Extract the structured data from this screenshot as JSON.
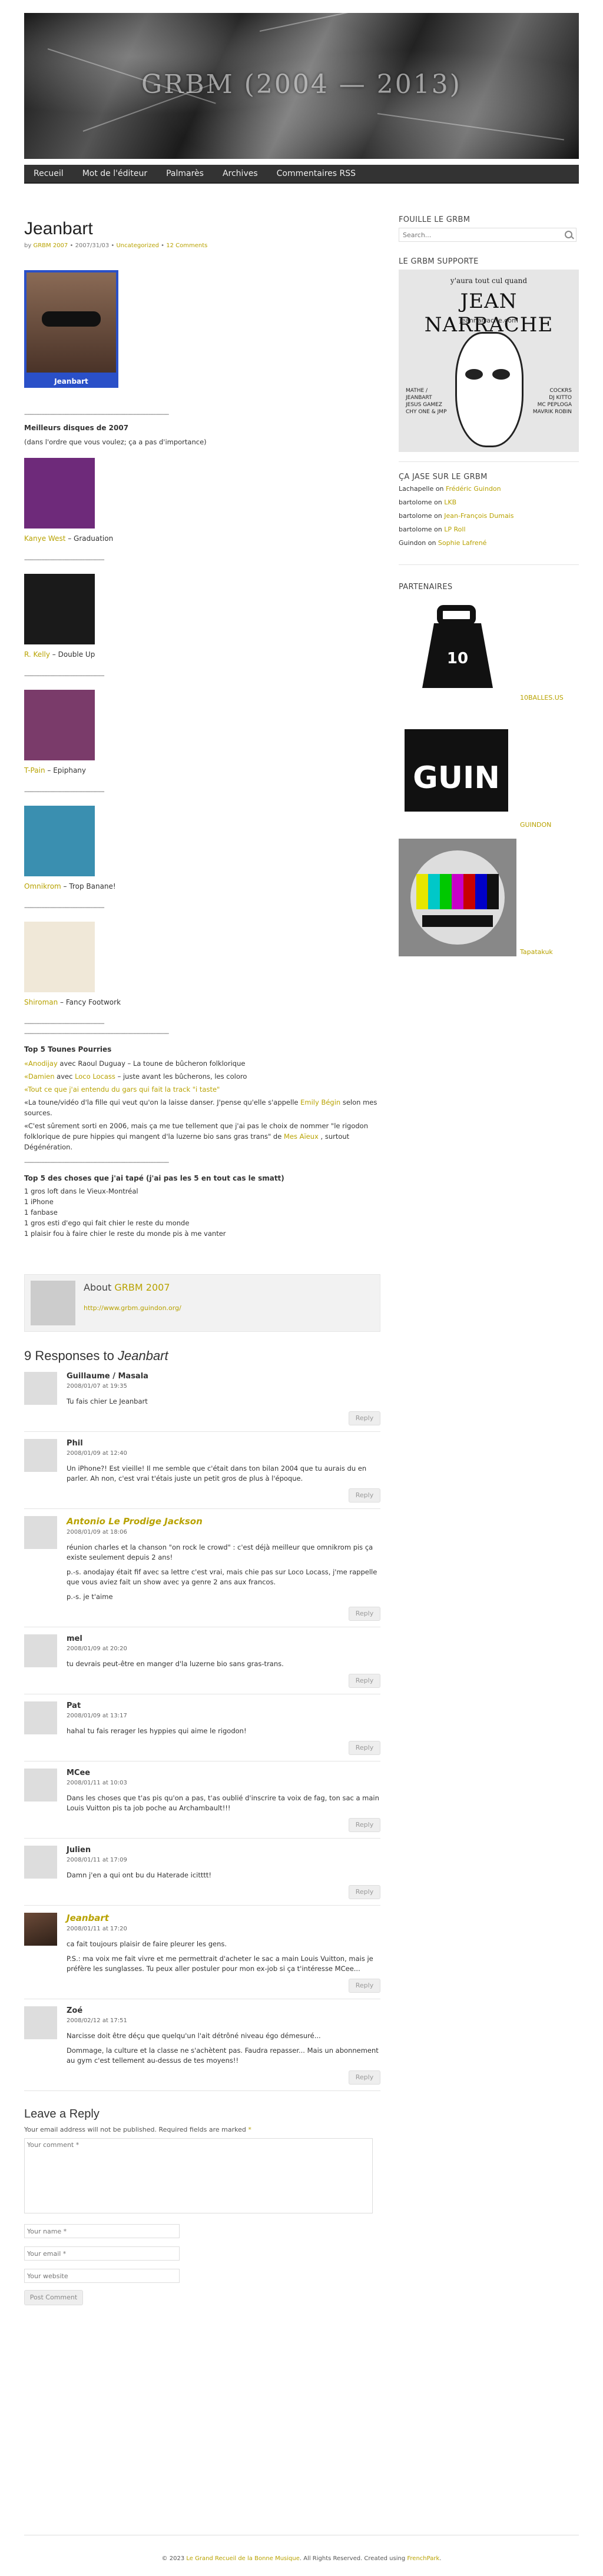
{
  "site": {
    "title": "GRBM (2004 — 2013)"
  },
  "nav": [
    {
      "label": "Recueil"
    },
    {
      "label": "Mot de l'éditeur"
    },
    {
      "label": "Palmarès"
    },
    {
      "label": "Archives"
    },
    {
      "label": "Commentaires RSS"
    }
  ],
  "post": {
    "title": "Jeanbart",
    "meta_by": "by",
    "meta_author": "GRBM 2007",
    "meta_sep1": "•",
    "meta_date": "2007/31/03",
    "meta_sep2": "•",
    "meta_category": "Uncategorized",
    "meta_sep3": "•",
    "meta_comments": "12 Comments",
    "avatar_caption": "Jeanbart",
    "separator": "----------------------------------------------------------------------------------------------",
    "separator_short": "----------------------------------------------------",
    "best_heading": "Meilleurs disques de 2007",
    "best_sub": "(dans l'ordre que vous voulez; ça a pas d'importance)",
    "albums": [
      {
        "artist": "Kanye West",
        "title": " – Graduation",
        "cover_color": "#6e2a7a"
      },
      {
        "artist": "R. Kelly",
        "title": " – Double Up",
        "cover_color": "#1a1a1a"
      },
      {
        "artist": "T-Pain",
        "title": " – Epiphany",
        "cover_color": "#7a3b6a"
      },
      {
        "artist": "Omnikrom",
        "title": " – Trop Banane!",
        "cover_color": "#3a8fb0"
      },
      {
        "artist": "Shiroman",
        "title": " – Fancy Footwork",
        "cover_color": "#f0e8d8"
      }
    ],
    "tounes_heading": "Top 5 Tounes Pourries",
    "tounes": [
      {
        "link": "«Anodijay",
        "rest": " avec Raoul Duguay – La toune de bûcheron folklorique"
      },
      {
        "link": "«Damien",
        "rest": " avec ",
        "link2": "Loco Locass",
        "rest2": " – juste avant les bûcherons, les coloro"
      },
      {
        "link": "«Tout ce que j'ai entendu du gars qui fait la track \"i taste\"",
        "rest": ""
      },
      {
        "link": "",
        "rest": "«La toune/vidéo d'la fille qui veut qu'on la laisse danser. J'pense qu'elle s'appelle ",
        "link2": "Emily Bégin",
        "rest2": " selon mes sources."
      },
      {
        "link": "",
        "rest": "«C'est sûrement sorti en 2006, mais ça me tue tellement que j'ai pas le choix de nommer \"le rigodon folklorique de pure hippies qui mangent d'la luzerne bio sans gras trans\" de ",
        "link2": "Mes Aïeux",
        "rest2": " , surtout Dégénération."
      }
    ],
    "choses_heading": "Top 5 des choses que j'ai tapé (j'ai pas les 5 en tout cas le smatt)",
    "choses": [
      "1 gros loft dans le Vieux-Montréal",
      "1 iPhone",
      "1 fanbase",
      "1 gros esti d'ego qui fait chier le reste du monde",
      "1 plaisir fou à faire chier le reste du monde pis à me vanter"
    ],
    "about_label": "About",
    "about_name": "GRBM 2007",
    "about_url": "http://www.grbm.guindon.org/"
  },
  "comments_heading_count": "9 Responses to",
  "comments_heading_title": "Jeanbart",
  "comments": [
    {
      "name": "Guillaume / Masala",
      "date": "2008/01/07 at 19:35",
      "texts": [
        "Tu fais chier Le Jeanbart"
      ],
      "author": false,
      "photo": false,
      "reply": "Reply"
    },
    {
      "name": "Phil",
      "date": "2008/01/09 at 12:40",
      "texts": [
        "Un iPhone?! Est vieille! Il me semble que c'était dans ton bilan 2004 que tu aurais du en parler. Ah non, c'est vrai t'étais juste un petit gros de plus à l'époque."
      ],
      "author": false,
      "photo": false,
      "reply": "Reply"
    },
    {
      "name": "Antonio Le Prodige Jackson",
      "date": "2008/01/09 at 18:06",
      "texts": [
        "réunion charles et la chanson \"on rock le crowd\" : c'est déjà meilleur que omnikrom pis ça existe seulement depuis 2 ans!",
        "p.-s. anodajay était fif avec sa lettre c'est vrai, mais chie pas sur Loco Locass, j'me rappelle que vous aviez fait un show avec ya genre 2 ans aux francos.",
        "p.-s. je t'aime"
      ],
      "author": true,
      "photo": false,
      "reply": "Reply"
    },
    {
      "name": "mel",
      "date": "2008/01/09 at 20:20",
      "texts": [
        "tu devrais peut-être en manger d'la luzerne bio sans gras-trans."
      ],
      "author": false,
      "photo": false,
      "reply": "Reply"
    },
    {
      "name": "Pat",
      "date": "2008/01/09 at 13:17",
      "texts": [
        "hahal tu fais rerager les hyppies qui aime le rigodon!"
      ],
      "author": false,
      "photo": false,
      "reply": "Reply"
    },
    {
      "name": "MCee",
      "date": "2008/01/11 at 10:03",
      "texts": [
        "Dans les choses que t'as pis qu'on a pas, t'as oublié d'inscrire ta voix de fag, ton sac a main Louis Vuitton pis ta job poche au Archambault!!!"
      ],
      "author": false,
      "photo": false,
      "reply": "Reply"
    },
    {
      "name": "Julien",
      "date": "2008/01/11 at 17:09",
      "texts": [
        "Damn j'en a qui ont bu du Haterade icitttt!"
      ],
      "author": false,
      "photo": false,
      "reply": "Reply"
    },
    {
      "name": "Jeanbart",
      "date": "2008/01/11 at 17:20",
      "texts": [
        "ca fait toujours plaisir de faire pleurer les gens.",
        "P.S.: ma voix me fait vivre et me permettrait d'acheter le sac a main Louis Vuitton, mais je préfère les sunglasses. Tu peux aller postuler pour mon ex-job si ça t'intéresse MCee..."
      ],
      "author": true,
      "photo": true,
      "reply": "Reply"
    },
    {
      "name": "Zoé",
      "date": "2008/02/12 at 17:51",
      "texts": [
        "Narcisse doit être déçu que quelqu'un l'ait détrôné niveau égo démesuré...",
        "Dommage, la culture et la classe ne s'achètent pas. Faudra repasser... Mais un abonnement au gym c'est tellement au-dessus de tes moyens!!"
      ],
      "author": false,
      "photo": false,
      "reply": "Reply"
    }
  ],
  "reply_form": {
    "title": "Leave a Reply",
    "notes": "Your email address will not be published. Required fields are marked",
    "required_mark": "*",
    "comment_placeholder": "Your comment *",
    "name_placeholder": "Your name *",
    "email_placeholder": "Your email *",
    "website_placeholder": "Your website",
    "submit_label": "Post Comment"
  },
  "sidebar": {
    "search_title": "FOUILLE LE GRBM",
    "search_placeholder": "Search...",
    "support_title": "LE GRBM SUPPORTE",
    "poster": {
      "top": "y'aura tout cul quand",
      "name": "JEAN NARRACHE",
      "url": "jeannarrache.com",
      "left": "MATHE /\nJEANBART\nJESUS GAMEZ\nCHY ONE & JMP",
      "right": "COCKRS\nDJ KITTO\nMC PEPLOGA\nMAVRIK ROBIN"
    },
    "recent_title": "ÇA JASE SUR LE GRBM",
    "recent": [
      {
        "who": "Lachapelle",
        "on": " on ",
        "post": "Frédéric Guindon"
      },
      {
        "who": "bartolome",
        "on": " on ",
        "post": "LKB"
      },
      {
        "who": "bartolome",
        "on": " on ",
        "post": "Jean-François Dumais"
      },
      {
        "who": "bartolome",
        "on": " on ",
        "post": "LP Roll"
      },
      {
        "who": "Guindon",
        "on": " on ",
        "post": "Sophie Lafrené"
      }
    ],
    "partners_title": "PARTENAIRES",
    "partners": [
      {
        "label": "10BALLES.US"
      },
      {
        "label": "GUINDON"
      },
      {
        "label": "Tapatakuk"
      }
    ]
  },
  "footer": {
    "prefix": "© 2023",
    "site": "Le Grand Recueil de la Bonne Musique",
    "middle": ". All Rights Reserved. Created using",
    "theme": "FrenchPark",
    "suffix": "."
  }
}
